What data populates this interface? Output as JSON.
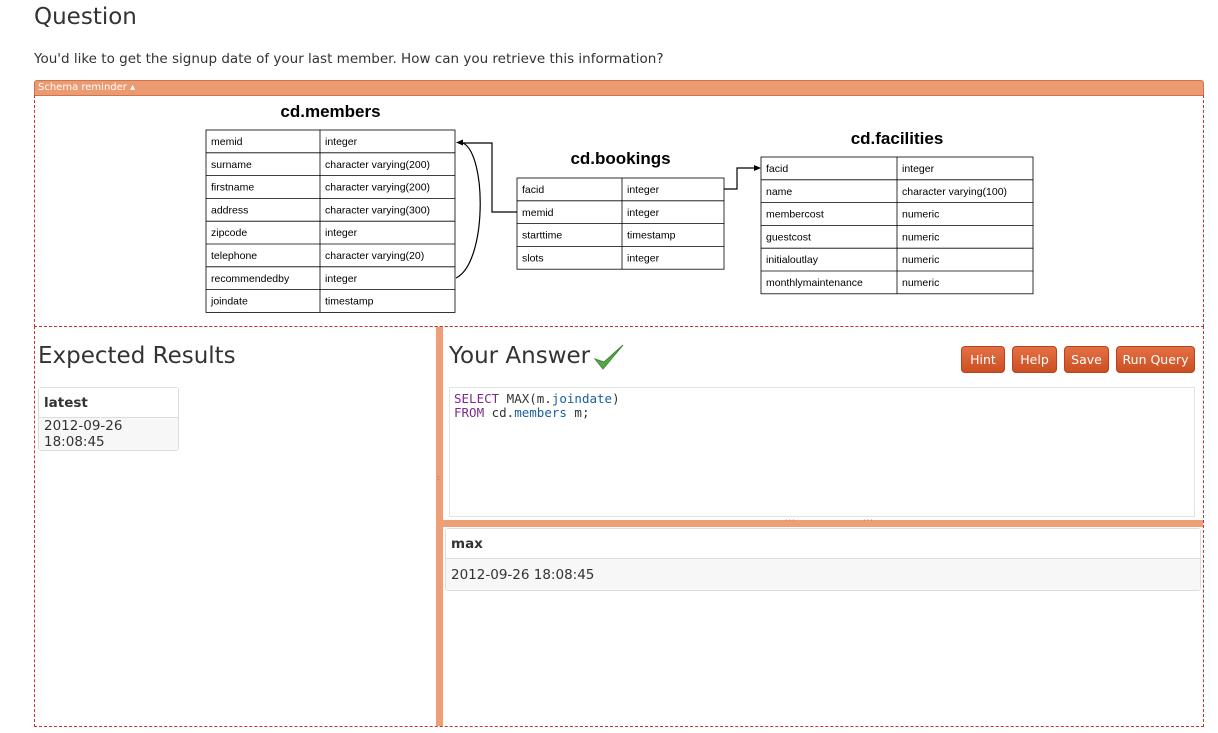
{
  "question": {
    "title": "Question",
    "text": "You'd like to get the signup date of your last member. How can you retrieve this information?"
  },
  "schema": {
    "toggle_label": "Schema reminder ▴",
    "tables": [
      {
        "name": "cd.members",
        "columns": [
          {
            "name": "memid",
            "type": "integer"
          },
          {
            "name": "surname",
            "type": "character varying(200)"
          },
          {
            "name": "firstname",
            "type": "character varying(200)"
          },
          {
            "name": "address",
            "type": "character varying(300)"
          },
          {
            "name": "zipcode",
            "type": "integer"
          },
          {
            "name": "telephone",
            "type": "character varying(20)"
          },
          {
            "name": "recommendedby",
            "type": "integer"
          },
          {
            "name": "joindate",
            "type": "timestamp"
          }
        ]
      },
      {
        "name": "cd.bookings",
        "columns": [
          {
            "name": "facid",
            "type": "integer"
          },
          {
            "name": "memid",
            "type": "integer"
          },
          {
            "name": "starttime",
            "type": "timestamp"
          },
          {
            "name": "slots",
            "type": "integer"
          }
        ]
      },
      {
        "name": "cd.facilities",
        "columns": [
          {
            "name": "facid",
            "type": "integer"
          },
          {
            "name": "name",
            "type": "character varying(100)"
          },
          {
            "name": "membercost",
            "type": "numeric"
          },
          {
            "name": "guestcost",
            "type": "numeric"
          },
          {
            "name": "initialoutlay",
            "type": "numeric"
          },
          {
            "name": "monthlymaintenance",
            "type": "numeric"
          }
        ]
      }
    ]
  },
  "expected": {
    "title": "Expected Results",
    "column": "latest",
    "value": "2012-09-26 18:08:45"
  },
  "answer": {
    "title": "Your Answer",
    "status_icon": "checkmark-icon",
    "buttons": {
      "hint": "Hint",
      "help": "Help",
      "save": "Save",
      "run": "Run Query"
    },
    "query": {
      "kw_select": "SELECT",
      "func": " MAX(m.",
      "col": "joindate",
      "close": ")",
      "kw_from": "FROM",
      "schema": " cd.",
      "table": "members",
      "alias": " m;"
    },
    "result": {
      "column": "max",
      "value": "2012-09-26 18:08:45"
    }
  },
  "colors": {
    "accent": "#eb9a71",
    "button": "#d65a2c",
    "check": "#5aa54a"
  }
}
